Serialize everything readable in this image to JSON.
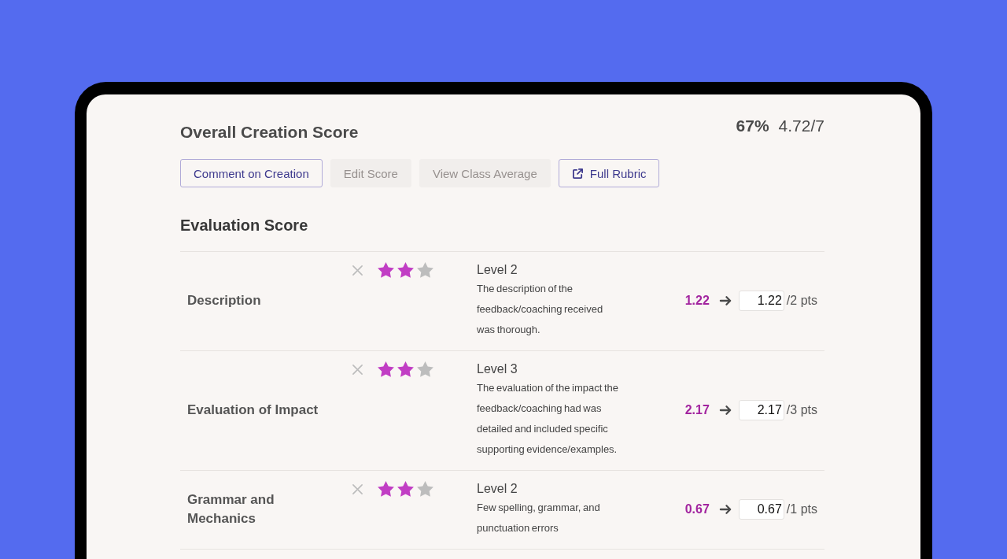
{
  "header": {
    "title": "Overall Creation Score",
    "percent": "67%",
    "score": "4.72/7"
  },
  "actions": [
    {
      "kind": "plain",
      "label": "Comment on Creation",
      "disabled": false
    },
    {
      "kind": "plain",
      "label": "Edit Score",
      "disabled": true
    },
    {
      "kind": "plain",
      "label": "View Class Average",
      "disabled": true
    },
    {
      "kind": "external",
      "label": "Full Rubric",
      "disabled": false
    }
  ],
  "evaluation": {
    "title": "Evaluation Score",
    "criteria": [
      {
        "name": "Description",
        "stars": 2,
        "level_label": "Level 2",
        "description": "The description of the feedback/coaching received was thorough.",
        "score": "1.22",
        "score_field": {
          "value": "1.22"
        },
        "max_points": "/2 pts"
      },
      {
        "name": "Evaluation of Impact",
        "stars": 2,
        "level_label": "Level 3",
        "description": "The evaluation of the impact the feedback/coaching had was detailed and included specific supporting evidence/examples.",
        "score": "2.17",
        "score_field": {
          "value": "2.17"
        },
        "max_points": "/3 pts"
      },
      {
        "name": "Grammar and Mechanics",
        "stars": 2,
        "level_label": "Level 2",
        "description": "Few spelling, grammar, and punctuation errors",
        "score": "0.67",
        "score_field": {
          "value": "0.67"
        },
        "max_points": "/1 pts"
      }
    ]
  }
}
